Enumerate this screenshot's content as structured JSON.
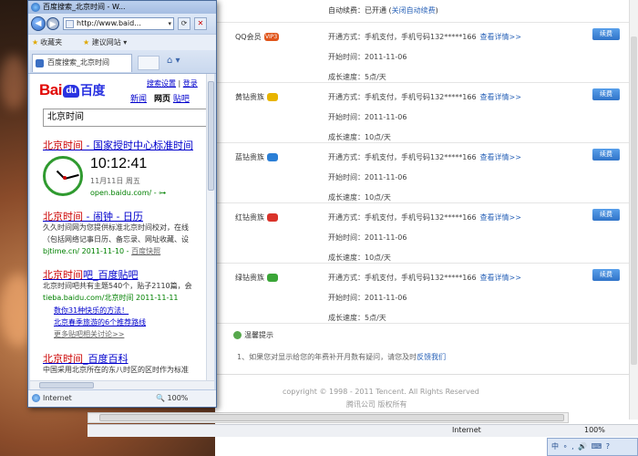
{
  "bg_page": {
    "auto_renew_label": "自动续费：已开通 (",
    "auto_renew_link": "关闭自动续费",
    "auto_renew_close": ")",
    "services": [
      {
        "name": "QQ会员",
        "badge_text": "VIP3",
        "badge_color": "#e0551b",
        "method": "开通方式：手机支付，手机号码132*****166",
        "details": "查看详情>>",
        "start": "开始时间：2011-11-06",
        "speed": "成长速度：5点/天",
        "renew": "续费"
      },
      {
        "name": "黄钻贵族",
        "badge_color": "#e8b400",
        "method": "开通方式：手机支付，手机号码132*****166",
        "details": "查看详情>>",
        "start": "开始时间：2011-11-06",
        "speed": "成长速度：10点/天",
        "renew": "续费"
      },
      {
        "name": "蓝钻贵族",
        "badge_color": "#2b7fd6",
        "method": "开通方式：手机支付，手机号码132*****166",
        "details": "查看详情>>",
        "start": "开始时间：2011-11-06",
        "speed": "成长速度：10点/天",
        "renew": "续费"
      },
      {
        "name": "红钻贵族",
        "badge_color": "#d9332a",
        "method": "开通方式：手机支付，手机号码132*****166",
        "details": "查看详情>>",
        "start": "开始时间：2011-11-06",
        "speed": "成长速度：10点/天",
        "renew": "续费"
      },
      {
        "name": "绿钻贵族",
        "badge_color": "#3aa537",
        "method": "开通方式：手机支付，手机号码132*****166",
        "details": "查看详情>>",
        "start": "开始时间：2011-11-06",
        "speed": "成长速度：5点/天",
        "renew": "续费"
      }
    ],
    "tips_title": "温馨提示",
    "tip_text": "1、如果您对显示给您的年费补开月数有疑问，请您及时",
    "tip_link": "反馈我们",
    "copyright": "copyright © 1998 - 2011 Tencent. All Rights Reserved",
    "company": "腾讯公司 版权所有",
    "status_zone": "Internet",
    "status_zoom": "100%"
  },
  "ime": "中 ∘ , 🔊 ⌨ ?",
  "ie": {
    "title": "百度搜索_北京时间 - W...",
    "address": "http://www.baid...",
    "favorites_label": "收藏夹",
    "suggested_sites": "建议网站 ▾",
    "tab_title": "百度搜索_北京时间",
    "status_zone": "Internet",
    "status_zoom": "100%"
  },
  "baidu": {
    "logo_bai": "Bai",
    "logo_du": "du",
    "logo_cn": "百度",
    "search_settings": "搜索设置",
    "login": "登录",
    "nav": [
      "新闻",
      "网页",
      "贴吧"
    ],
    "query": "北京时间",
    "results": [
      {
        "title": "北京时间 - 国家授时中心标准时间",
        "time": "10:12:41",
        "date": "11月11日   周五",
        "url": "open.baidu.com/ - ⊶"
      },
      {
        "title": "北京时间 - 闹钟 - 日历",
        "snip1": "久久时间网为您提供标准北京时间校对，在线",
        "snip2": "（包括网络记事日历、备忘录、网址收藏、设",
        "url": "bjtime.cn/ 2011-11-10 - ",
        "cache": "百度快照"
      },
      {
        "title": "北京时间吧_百度贴吧",
        "snip1": "北京时间吧共有主题540个，贴子2110篇，会",
        "url": "tieba.baidu.com/北京时间  2011-11-11",
        "sub": [
          "数你31种快乐的方法！",
          "北京春季旅游的6个推荐路线",
          "更多贴吧相关讨论>>"
        ]
      },
      {
        "title": "北京时间_百度百科",
        "snip1": "中国采用北京所在的东八时区的区时作为标准"
      }
    ]
  }
}
